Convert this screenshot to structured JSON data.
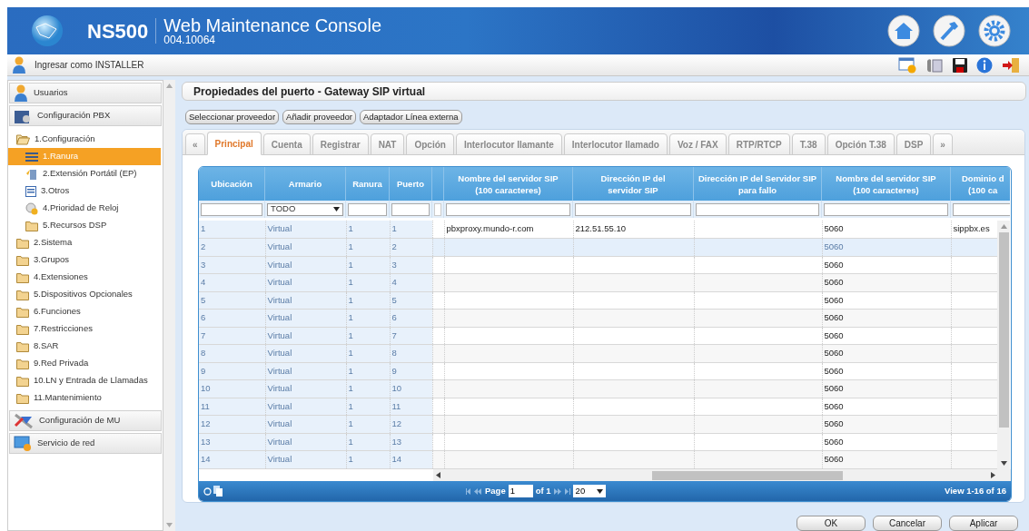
{
  "header": {
    "product": "NS500",
    "title": "Web Maintenance Console",
    "version": "004.10064"
  },
  "toolbar": {
    "login": "Ingresar como INSTALLER"
  },
  "sidebar": {
    "sections": [
      {
        "label": "Usuarios",
        "kind": "users"
      },
      {
        "label": "Configuración PBX",
        "kind": "pbx",
        "children": [
          {
            "label": "1.Configuración",
            "kind": "folder",
            "expanded": true,
            "selected": false,
            "children": [
              {
                "label": "1.Ranura",
                "kind": "slot",
                "selected": true
              },
              {
                "label": "2.Extensión Portátil (EP)",
                "kind": "portable",
                "selected": false
              },
              {
                "label": "3.Otros",
                "kind": "list",
                "selected": false
              },
              {
                "label": "4.Prioridad de Reloj",
                "kind": "clock",
                "selected": false
              },
              {
                "label": "5.Recursos DSP",
                "kind": "folder",
                "expanded": false,
                "selected": false
              }
            ]
          },
          {
            "label": "2.Sistema",
            "kind": "folder",
            "expanded": false,
            "selected": false
          },
          {
            "label": "3.Grupos",
            "kind": "folder",
            "expanded": false,
            "selected": false
          },
          {
            "label": "4.Extensiones",
            "kind": "folder",
            "expanded": false,
            "selected": false
          },
          {
            "label": "5.Dispositivos Opcionales",
            "kind": "folder",
            "expanded": false,
            "selected": false
          },
          {
            "label": "6.Funciones",
            "kind": "folder",
            "expanded": false,
            "selected": false
          },
          {
            "label": "7.Restricciones",
            "kind": "folder",
            "expanded": false,
            "selected": false
          },
          {
            "label": "8.SAR",
            "kind": "folder",
            "expanded": false,
            "selected": false
          },
          {
            "label": "9.Red Privada",
            "kind": "folder",
            "expanded": false,
            "selected": false
          },
          {
            "label": "10.LN y Entrada de Llamadas",
            "kind": "folder",
            "expanded": false,
            "selected": false
          },
          {
            "label": "11.Mantenimiento",
            "kind": "folder",
            "expanded": false,
            "selected": false
          }
        ]
      },
      {
        "label": "Configuración de MU",
        "kind": "mu"
      },
      {
        "label": "Servicio de red",
        "kind": "network"
      }
    ]
  },
  "page_title": "Propiedades del puerto - Gateway SIP virtual",
  "action_buttons": [
    "Seleccionar proveedor",
    "Añadir proveedor",
    "Adaptador Línea externa"
  ],
  "tabs": [
    {
      "label": "«",
      "kind": "scroll",
      "selected": false
    },
    {
      "label": "Principal",
      "selected": true
    },
    {
      "label": "Cuenta",
      "selected": false
    },
    {
      "label": "Registrar",
      "selected": false
    },
    {
      "label": "NAT",
      "selected": false
    },
    {
      "label": "Opción",
      "selected": false
    },
    {
      "label": "Interlocutor llamante",
      "selected": false
    },
    {
      "label": "Interlocutor llamado",
      "selected": false
    },
    {
      "label": "Voz / FAX",
      "selected": false
    },
    {
      "label": "RTP/RTCP",
      "selected": false
    },
    {
      "label": "T.38",
      "selected": false
    },
    {
      "label": "Opción T.38",
      "selected": false
    },
    {
      "label": "DSP",
      "selected": false
    },
    {
      "label": "»",
      "kind": "scroll",
      "selected": false
    }
  ],
  "table": {
    "columns": [
      {
        "lines": [
          "Ubicación"
        ]
      },
      {
        "lines": [
          "Armario"
        ],
        "filter": "TODO"
      },
      {
        "lines": [
          "Ranura"
        ]
      },
      {
        "lines": [
          "Puerto"
        ]
      },
      {
        "kind": "spacer"
      },
      {
        "lines": [
          "Nombre del servidor SIP",
          "(100 caracteres)"
        ]
      },
      {
        "lines": [
          "Dirección IP del",
          "servidor SIP"
        ]
      },
      {
        "lines": [
          "Dirección IP del Servidor SIP",
          "para fallo"
        ]
      },
      {
        "lines": [
          "Nombre del servidor SIP",
          "(100 caracteres)"
        ]
      },
      {
        "lines": [
          "Dominio d",
          "(100 ca"
        ]
      }
    ],
    "rows": [
      {
        "selected": false,
        "cells": [
          "1",
          "Virtual",
          "1",
          "1",
          null,
          "pbxproxy.mundo-r.com",
          "212.51.55.10",
          null,
          "5060",
          "sippbx.es"
        ]
      },
      {
        "selected": true,
        "cells": [
          "2",
          "Virtual",
          "1",
          "2",
          null,
          null,
          null,
          null,
          "5060",
          null
        ]
      },
      {
        "selected": false,
        "cells": [
          "3",
          "Virtual",
          "1",
          "3",
          null,
          null,
          null,
          null,
          "5060",
          null
        ]
      },
      {
        "selected": false,
        "cells": [
          "4",
          "Virtual",
          "1",
          "4",
          null,
          null,
          null,
          null,
          "5060",
          null
        ]
      },
      {
        "selected": false,
        "cells": [
          "5",
          "Virtual",
          "1",
          "5",
          null,
          null,
          null,
          null,
          "5060",
          null
        ]
      },
      {
        "selected": false,
        "cells": [
          "6",
          "Virtual",
          "1",
          "6",
          null,
          null,
          null,
          null,
          "5060",
          null
        ]
      },
      {
        "selected": false,
        "cells": [
          "7",
          "Virtual",
          "1",
          "7",
          null,
          null,
          null,
          null,
          "5060",
          null
        ]
      },
      {
        "selected": false,
        "cells": [
          "8",
          "Virtual",
          "1",
          "8",
          null,
          null,
          null,
          null,
          "5060",
          null
        ]
      },
      {
        "selected": false,
        "cells": [
          "9",
          "Virtual",
          "1",
          "9",
          null,
          null,
          null,
          null,
          "5060",
          null
        ]
      },
      {
        "selected": false,
        "cells": [
          "10",
          "Virtual",
          "1",
          "10",
          null,
          null,
          null,
          null,
          "5060",
          null
        ]
      },
      {
        "selected": false,
        "cells": [
          "11",
          "Virtual",
          "1",
          "11",
          null,
          null,
          null,
          null,
          "5060",
          null
        ]
      },
      {
        "selected": false,
        "cells": [
          "12",
          "Virtual",
          "1",
          "12",
          null,
          null,
          null,
          null,
          "5060",
          null
        ]
      },
      {
        "selected": false,
        "cells": [
          "13",
          "Virtual",
          "1",
          "13",
          null,
          null,
          null,
          null,
          "5060",
          null
        ]
      },
      {
        "selected": false,
        "cells": [
          "14",
          "Virtual",
          "1",
          "14",
          null,
          null,
          null,
          null,
          "5060",
          null
        ]
      }
    ],
    "pager": {
      "page_label": "Page",
      "page": "1",
      "of": "of 1",
      "page_size": "20",
      "view": "View 1-16 of 16"
    }
  },
  "footer_buttons": [
    "OK",
    "Cancelar",
    "Aplicar"
  ]
}
